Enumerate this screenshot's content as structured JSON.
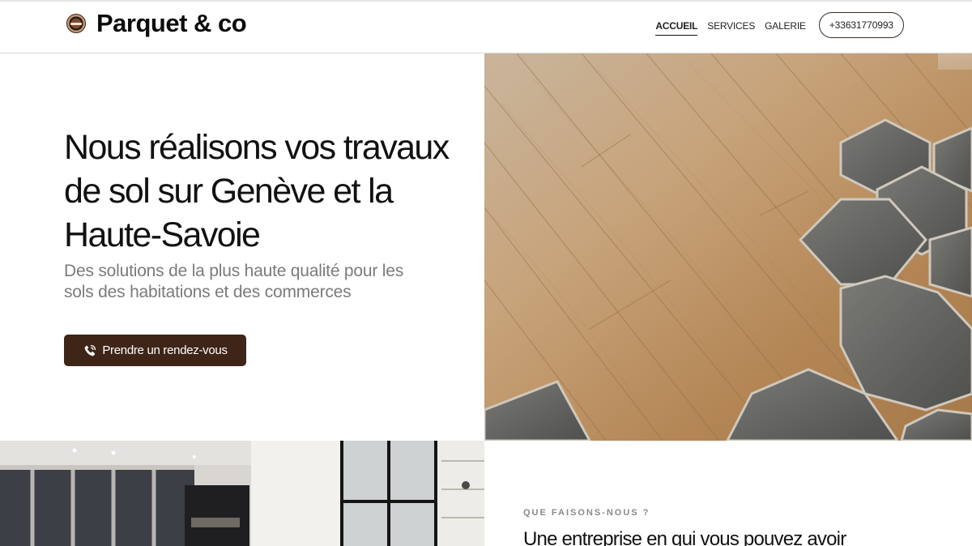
{
  "header": {
    "brand": "Parquet & co",
    "logo_icon": "parquet-logo-icon",
    "nav": [
      {
        "label": "ACCUEIL",
        "active": true
      },
      {
        "label": "SERVICES",
        "active": false
      },
      {
        "label": "GALERIE",
        "active": false
      }
    ],
    "phone": "+33631770993"
  },
  "hero": {
    "title_lines": [
      "Nous réalisons vos travaux",
      "de sol sur Genève et la",
      "Haute-Savoie"
    ],
    "subtitle_lines": [
      "Des solutions de la plus haute qualité pour les",
      "sols des habitations et des commerces"
    ],
    "cta_label": "Prendre un rendez-vous",
    "cta_icon": "phone-icon",
    "image": "wood-floor-hexagon-tiles-photo"
  },
  "about": {
    "eyebrow": "QUE FAISONS-NOUS ?",
    "title": "Une entreprise en qui vous pouvez avoir",
    "image": "interior-kitchen-photo"
  },
  "colors": {
    "brand_brown": "#3f2418",
    "text_dark": "#111111",
    "text_muted": "#7b7b7b"
  }
}
